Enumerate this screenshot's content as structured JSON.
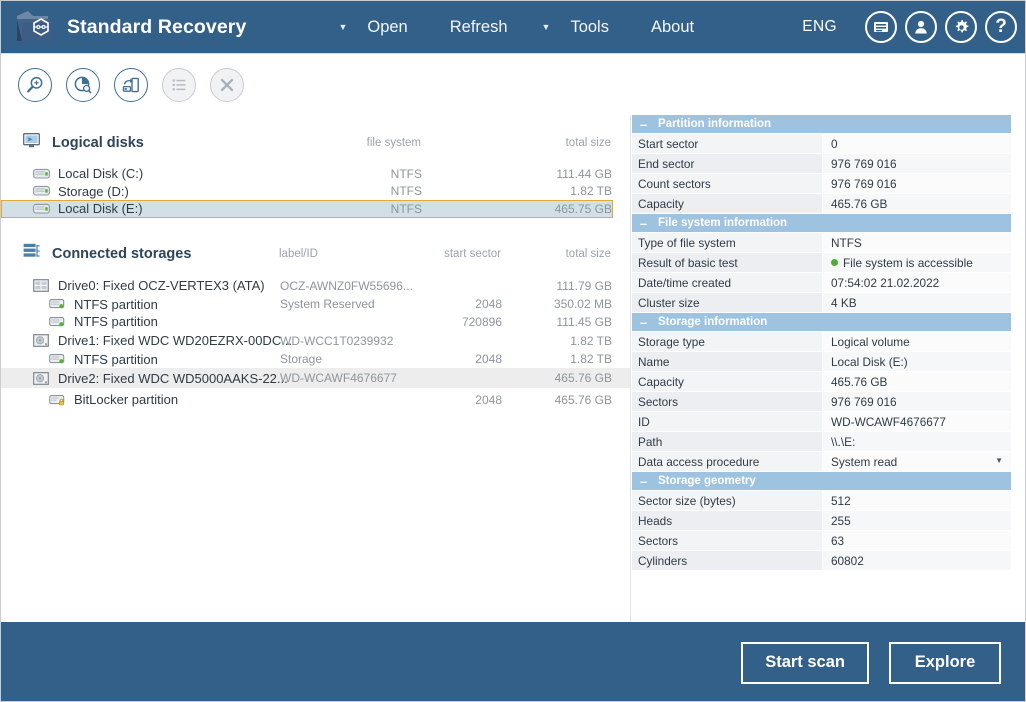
{
  "header": {
    "title": "Standard Recovery",
    "logo_icon": "folder-recovery-logo-icon",
    "nav": [
      {
        "type": "caret",
        "label": "▼",
        "name": "open-dropdown-caret"
      },
      {
        "type": "item",
        "label": "Open",
        "name": "nav-open"
      },
      {
        "type": "item",
        "label": "Refresh",
        "name": "nav-refresh"
      },
      {
        "type": "caret",
        "label": "▼",
        "name": "tools-dropdown-caret"
      },
      {
        "type": "item",
        "label": "Tools",
        "name": "nav-tools"
      },
      {
        "type": "item",
        "label": "About",
        "name": "nav-about"
      }
    ],
    "language": "ENG",
    "buttons": [
      {
        "name": "news-icon",
        "title": "News"
      },
      {
        "name": "user-icon",
        "title": "Account"
      },
      {
        "name": "gear-icon",
        "title": "Settings"
      },
      {
        "name": "help-icon",
        "title": "Help",
        "glyph": "?"
      }
    ]
  },
  "toolbar": {
    "buttons": [
      {
        "name": "find-storage-icon",
        "enabled": true
      },
      {
        "name": "disk-scan-icon",
        "enabled": true
      },
      {
        "name": "disk-image-icon",
        "enabled": true
      },
      {
        "name": "list-view-icon",
        "enabled": false
      },
      {
        "name": "close-icon",
        "enabled": false
      }
    ]
  },
  "logical_disks": {
    "title": "Logical disks",
    "icon": "monitor-icon",
    "columns": {
      "file_system": "file system",
      "total_size": "total size"
    },
    "rows": [
      {
        "icon": "drive-icon",
        "label": "Local Disk (C:)",
        "file_system": "NTFS",
        "total_size": "111.44 GB",
        "state": "normal"
      },
      {
        "icon": "drive-icon",
        "label": "Storage (D:)",
        "file_system": "NTFS",
        "total_size": "1.82 TB",
        "state": "normal"
      },
      {
        "icon": "drive-icon",
        "label": "Local Disk (E:)",
        "file_system": "NTFS",
        "total_size": "465.75 GB",
        "state": "selected"
      }
    ]
  },
  "connected_storages": {
    "title": "Connected storages",
    "icon": "storages-icon",
    "columns": {
      "label_id": "label/ID",
      "start_sector": "start sector",
      "total_size": "total size"
    },
    "rows": [
      {
        "icon": "disk-drive-icon",
        "indent": 1,
        "label": "Drive0: Fixed OCZ-VERTEX3 (ATA)",
        "label_id": "OCZ-AWNZ0FW55696...",
        "start_sector": "",
        "total_size": "111.79 GB",
        "state": "normal"
      },
      {
        "icon": "partition-icon",
        "indent": 2,
        "label": "NTFS partition",
        "label_id": "System Reserved",
        "start_sector": "2048",
        "total_size": "350.02 MB",
        "state": "normal"
      },
      {
        "icon": "partition-icon",
        "indent": 2,
        "label": "NTFS partition",
        "label_id": "",
        "start_sector": "720896",
        "total_size": "111.45 GB",
        "state": "normal"
      },
      {
        "icon": "hdd-icon",
        "indent": 1,
        "label": "Drive1: Fixed WDC WD20EZRX-00DC...",
        "label_id": "WD-WCC1T0239932",
        "start_sector": "",
        "total_size": "1.82 TB",
        "state": "normal"
      },
      {
        "icon": "partition-icon",
        "indent": 2,
        "label": "NTFS partition",
        "label_id": "Storage",
        "start_sector": "2048",
        "total_size": "1.82 TB",
        "state": "normal"
      },
      {
        "icon": "hdd-icon",
        "indent": 1,
        "label": "Drive2: Fixed WDC WD5000AAKS-22...",
        "label_id": "WD-WCAWF4676677",
        "start_sector": "",
        "total_size": "465.76 GB",
        "state": "highlighted"
      },
      {
        "icon": "locked-partition-icon",
        "indent": 2,
        "label": "BitLocker partition",
        "label_id": "",
        "start_sector": "2048",
        "total_size": "465.76 GB",
        "state": "normal"
      }
    ]
  },
  "details": {
    "sections": [
      {
        "title": "Partition information",
        "collapse_glyph": "–",
        "rows": [
          {
            "key": "Start sector",
            "value": "0"
          },
          {
            "key": "End sector",
            "value": "976 769 016"
          },
          {
            "key": "Count sectors",
            "value": "976 769 016"
          },
          {
            "key": "Capacity",
            "value": "465.76 GB"
          }
        ]
      },
      {
        "title": "File system information",
        "collapse_glyph": "–",
        "rows": [
          {
            "key": "Type of file system",
            "value": "NTFS"
          },
          {
            "key": "Result of basic test",
            "value": "File system is accessible",
            "status": "ok"
          },
          {
            "key": "Date/time created",
            "value": "07:54:02 21.02.2022"
          },
          {
            "key": "Cluster size",
            "value": "4 KB"
          }
        ]
      },
      {
        "title": "Storage information",
        "collapse_glyph": "–",
        "rows": [
          {
            "key": "Storage type",
            "value": "Logical volume"
          },
          {
            "key": "Name",
            "value": "Local Disk (E:)"
          },
          {
            "key": "Capacity",
            "value": "465.76 GB"
          },
          {
            "key": "Sectors",
            "value": "976 769 016"
          },
          {
            "key": "ID",
            "value": "WD-WCAWF4676677"
          },
          {
            "key": "Path",
            "value": "\\\\.\\E:"
          },
          {
            "key": "Data access procedure",
            "value": "System read",
            "control": "dropdown"
          }
        ]
      },
      {
        "title": "Storage geometry",
        "collapse_glyph": "–",
        "rows": [
          {
            "key": "Sector size (bytes)",
            "value": "512"
          },
          {
            "key": "Heads",
            "value": "255"
          },
          {
            "key": "Sectors",
            "value": "63"
          },
          {
            "key": "Cylinders",
            "value": "60802"
          }
        ]
      }
    ]
  },
  "footer": {
    "start_scan": "Start scan",
    "explore": "Explore"
  },
  "colors": {
    "brand_blue": "#336089",
    "section_header": "#9dc3e0",
    "selection_outline": "#e3a93b",
    "selection_fill": "#d4dee6",
    "status_ok": "#4cae2e"
  }
}
